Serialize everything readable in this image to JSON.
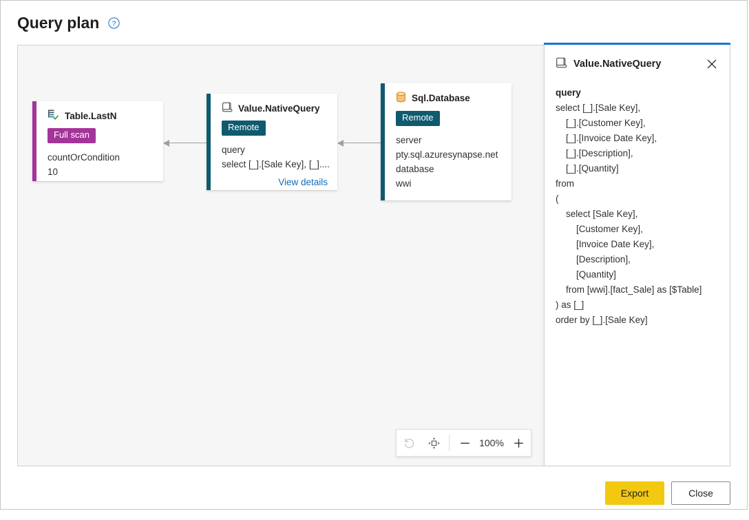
{
  "header": {
    "title": "Query plan",
    "help_icon": "question-circle-icon"
  },
  "canvas": {
    "nodes": [
      {
        "id": "table-lastn",
        "icon": "table-check-icon",
        "title": "Table.LastN",
        "badge": "Full scan",
        "badge_color": "#a4349a",
        "accent_color": "#a4349a",
        "props": [
          {
            "name": "countOrCondition",
            "value": "10"
          }
        ],
        "link": null
      },
      {
        "id": "value-nativequery",
        "icon": "scroll-icon",
        "title": "Value.NativeQuery",
        "badge": "Remote",
        "badge_color": "#0f5a6e",
        "accent_color": "#0f5a6e",
        "props": [
          {
            "name": "query",
            "value": "select [_].[Sale Key], [_]...."
          }
        ],
        "link": "View details"
      },
      {
        "id": "sql-database",
        "icon": "database-icon",
        "title": "Sql.Database",
        "badge": "Remote",
        "badge_color": "#0f5a6e",
        "accent_color": "#0f5a6e",
        "props": [
          {
            "name": "server",
            "value": "pty.sql.azuresynapse.net"
          },
          {
            "name": "database",
            "value": "wwi"
          }
        ],
        "link": null
      }
    ],
    "zoom_toolbar": {
      "reset_icon": "undo-icon",
      "fit_icon": "fit-to-view-icon",
      "zoom_out_icon": "minus-icon",
      "zoom_in_icon": "plus-icon",
      "zoom_level": "100%"
    }
  },
  "side_panel": {
    "icon": "scroll-icon",
    "title": "Value.NativeQuery",
    "close_icon": "close-icon",
    "accent_color": "#0f78d4",
    "property_name": "query",
    "query_text": "select [_].[Sale Key],\n    [_].[Customer Key],\n    [_].[Invoice Date Key],\n    [_].[Description],\n    [_].[Quantity]\nfrom\n(\n    select [Sale Key],\n        [Customer Key],\n        [Invoice Date Key],\n        [Description],\n        [Quantity]\n    from [wwi].[fact_Sale] as [$Table]\n) as [_]\norder by [_].[Sale Key]"
  },
  "footer": {
    "export_label": "Export",
    "close_label": "Close",
    "export_color": "#f2c811"
  }
}
